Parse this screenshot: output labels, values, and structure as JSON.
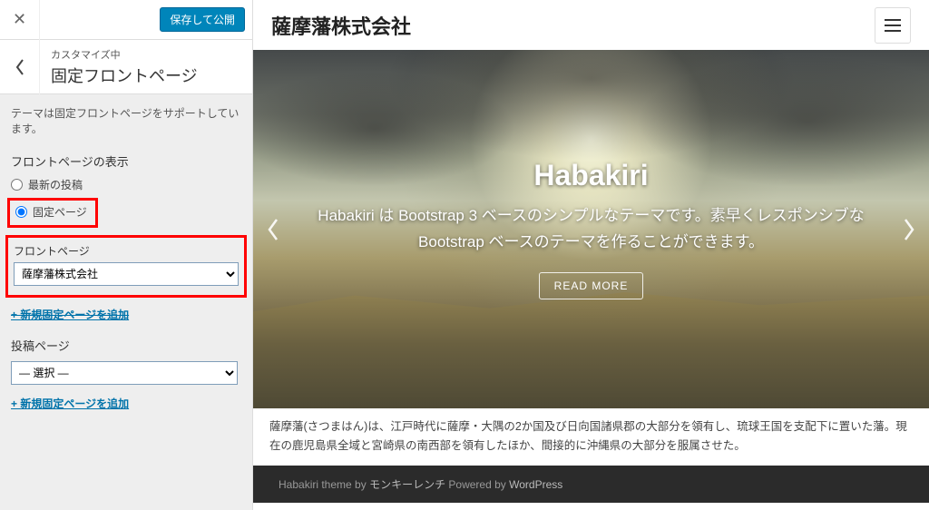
{
  "sidebar": {
    "publish_label": "保存して公開",
    "customizing_small": "カスタマイズ中",
    "section_title": "固定フロントページ",
    "description": "テーマは固定フロントページをサポートしています。",
    "frontpage_display_label": "フロントページの表示",
    "radio_latest": "最新の投稿",
    "radio_static": "固定ページ",
    "frontpage_label": "フロントページ",
    "frontpage_selected": "薩摩藩株式会社",
    "add_front_link": "+ 新規固定ページを追加",
    "posts_page_label": "投稿ページ",
    "posts_page_selected": "— 選択 —",
    "add_posts_link": "+ 新規固定ページを追加"
  },
  "preview": {
    "site_title": "薩摩藩株式会社",
    "hero_title": "Habakiri",
    "hero_desc": "Habakiri は Bootstrap 3 ベースのシンプルなテーマです。素早くレスポンシブな Bootstrap ベースのテーマを作ることができます。",
    "read_more": "READ MORE",
    "article_text": "薩摩藩(さつまはん)は、江戸時代に薩摩・大隅の2か国及び日向国諸県郡の大部分を領有し、琉球王国を支配下に置いた藩。現在の鹿児島県全域と宮崎県の南西部を領有したほか、間接的に沖縄県の大部分を服属させた。",
    "footer_theme_prefix": "Habakiri theme ",
    "footer_by": "by ",
    "footer_author": "モンキーレンチ",
    "footer_powered": " Powered by ",
    "footer_wp": "WordPress"
  }
}
